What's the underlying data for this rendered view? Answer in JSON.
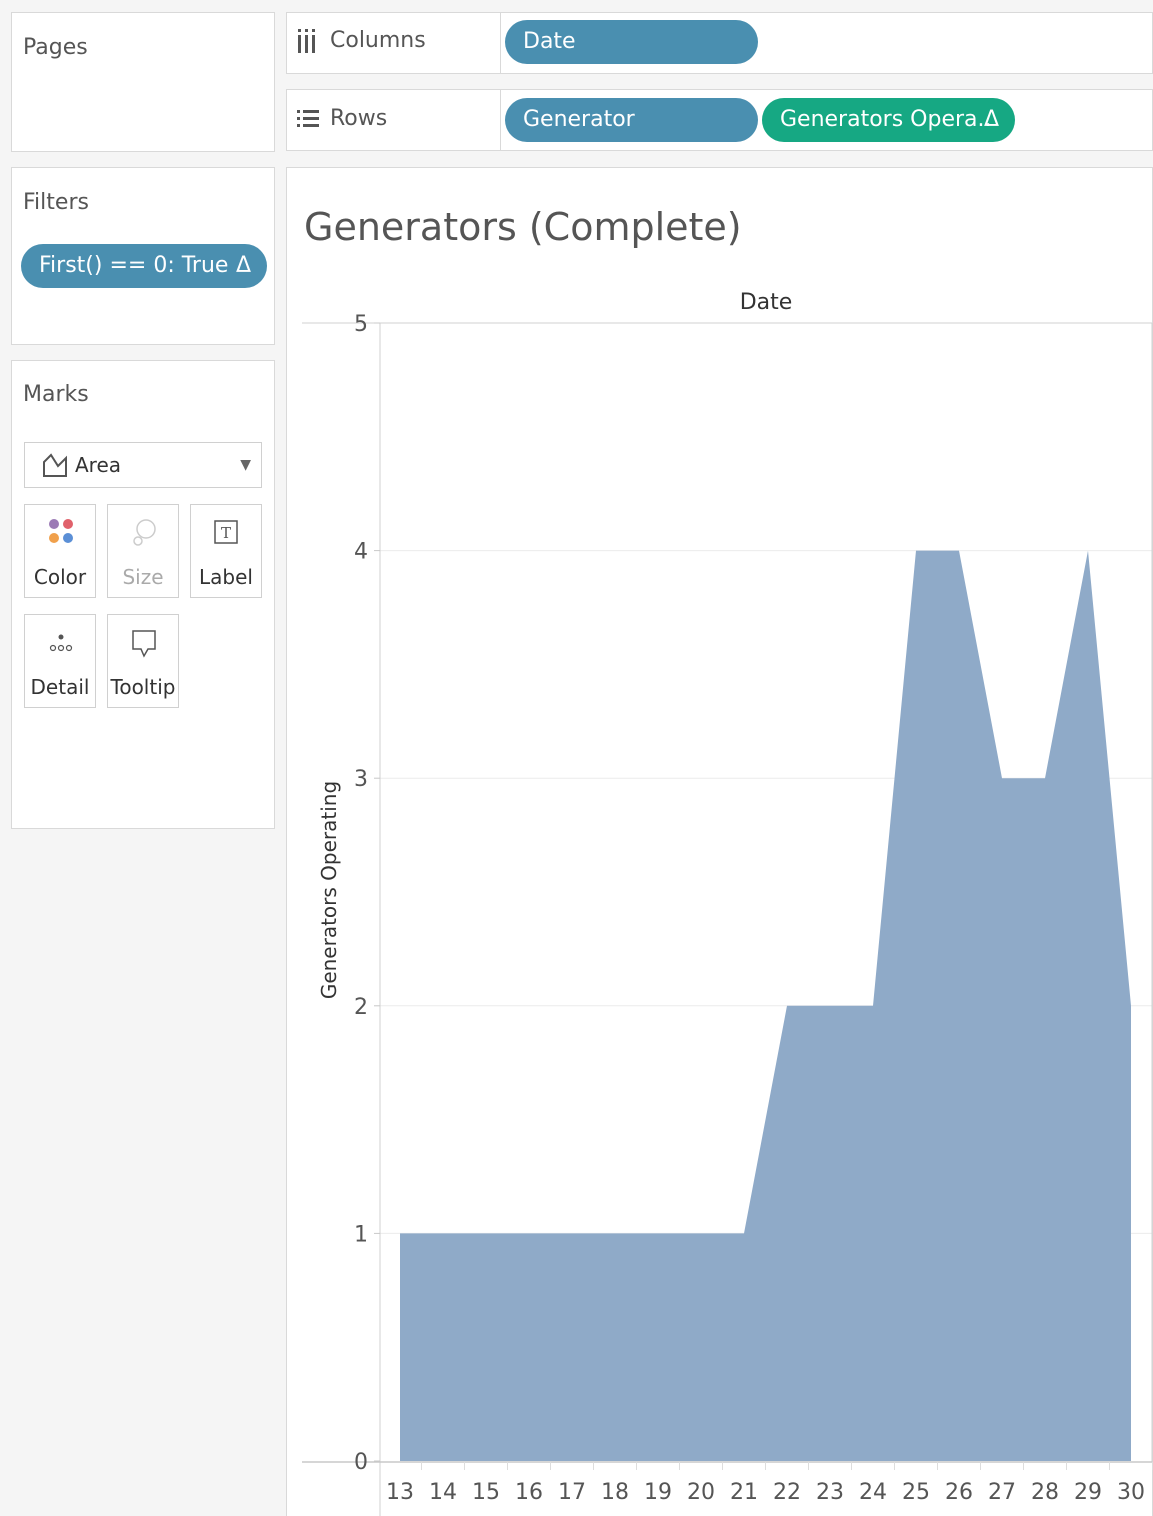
{
  "shelves": {
    "columns_label": "Columns",
    "rows_label": "Rows",
    "columns_pills": [
      "Date"
    ],
    "rows_pills": [
      "Generator",
      "Generators Opera.."
    ],
    "delta_glyph": "Δ"
  },
  "left_panel": {
    "pages_title": "Pages",
    "filters_title": "Filters",
    "filter_pill": "First() == 0: True",
    "marks_title": "Marks",
    "mark_type": "Area",
    "mark_buttons": {
      "color": "Color",
      "size": "Size",
      "label": "Label",
      "detail": "Detail",
      "tooltip": "Tooltip"
    }
  },
  "colors": {
    "pill_blue": "#4a8fb0",
    "pill_green": "#16a883",
    "area_fill": "#8faac8"
  },
  "chart_data": {
    "type": "area",
    "title": "Generators (Complete)",
    "xlabel": "Date",
    "ylabel": "Generators Operating",
    "x": [
      13,
      14,
      15,
      16,
      17,
      18,
      19,
      20,
      21,
      22,
      23,
      24,
      25,
      26,
      27,
      28,
      29,
      30
    ],
    "values": [
      1,
      1,
      1,
      1,
      1,
      1,
      1,
      1,
      1,
      2,
      2,
      2,
      4,
      4,
      3,
      3,
      4,
      2
    ],
    "yticks": [
      0,
      1,
      2,
      3,
      4,
      5
    ],
    "ylim": [
      0,
      5
    ],
    "grid": true
  }
}
